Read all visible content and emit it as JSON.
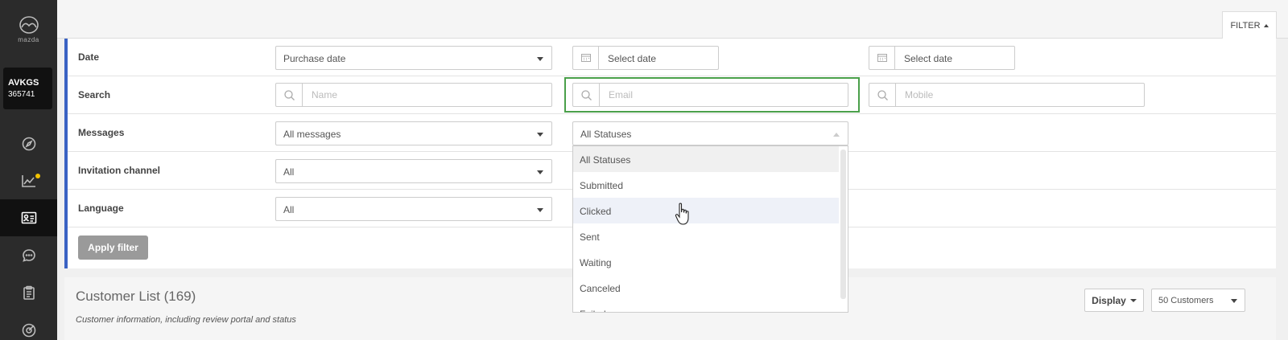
{
  "sidebar": {
    "logo_text": "mazda",
    "dealer_name": "AVKGS",
    "dealer_id": "365741",
    "colors": {
      "background": "#2b2b2b",
      "active": "#111111",
      "notification_dot": "#f2c200"
    }
  },
  "filter_toggle": {
    "label": "FILTER"
  },
  "filters": {
    "date": {
      "label": "Date",
      "type_value": "Purchase date",
      "start_placeholder": "Select date",
      "end_placeholder": "Select date"
    },
    "search": {
      "label": "Search",
      "name_placeholder": "Name",
      "email_placeholder": "Email",
      "mobile_placeholder": "Mobile"
    },
    "messages": {
      "label": "Messages",
      "messages_value": "All messages",
      "status_value": "All Statuses"
    },
    "invitation_channel": {
      "label": "Invitation channel",
      "value": "All"
    },
    "language": {
      "label": "Language",
      "value": "All"
    }
  },
  "apply_button": {
    "label": "Apply filter"
  },
  "status_dropdown": {
    "options": [
      "All Statuses",
      "Submitted",
      "Clicked",
      "Sent",
      "Waiting",
      "Canceled",
      "Failed"
    ]
  },
  "customer_list": {
    "title": "Customer List (169)",
    "subtitle": "Customer information, including review portal and status",
    "display_label": "Display",
    "page_size": "50 Customers"
  },
  "colors": {
    "accent": "#3a62c3",
    "highlight": "#4aa04a",
    "apply_button": "#9a9a9a"
  }
}
